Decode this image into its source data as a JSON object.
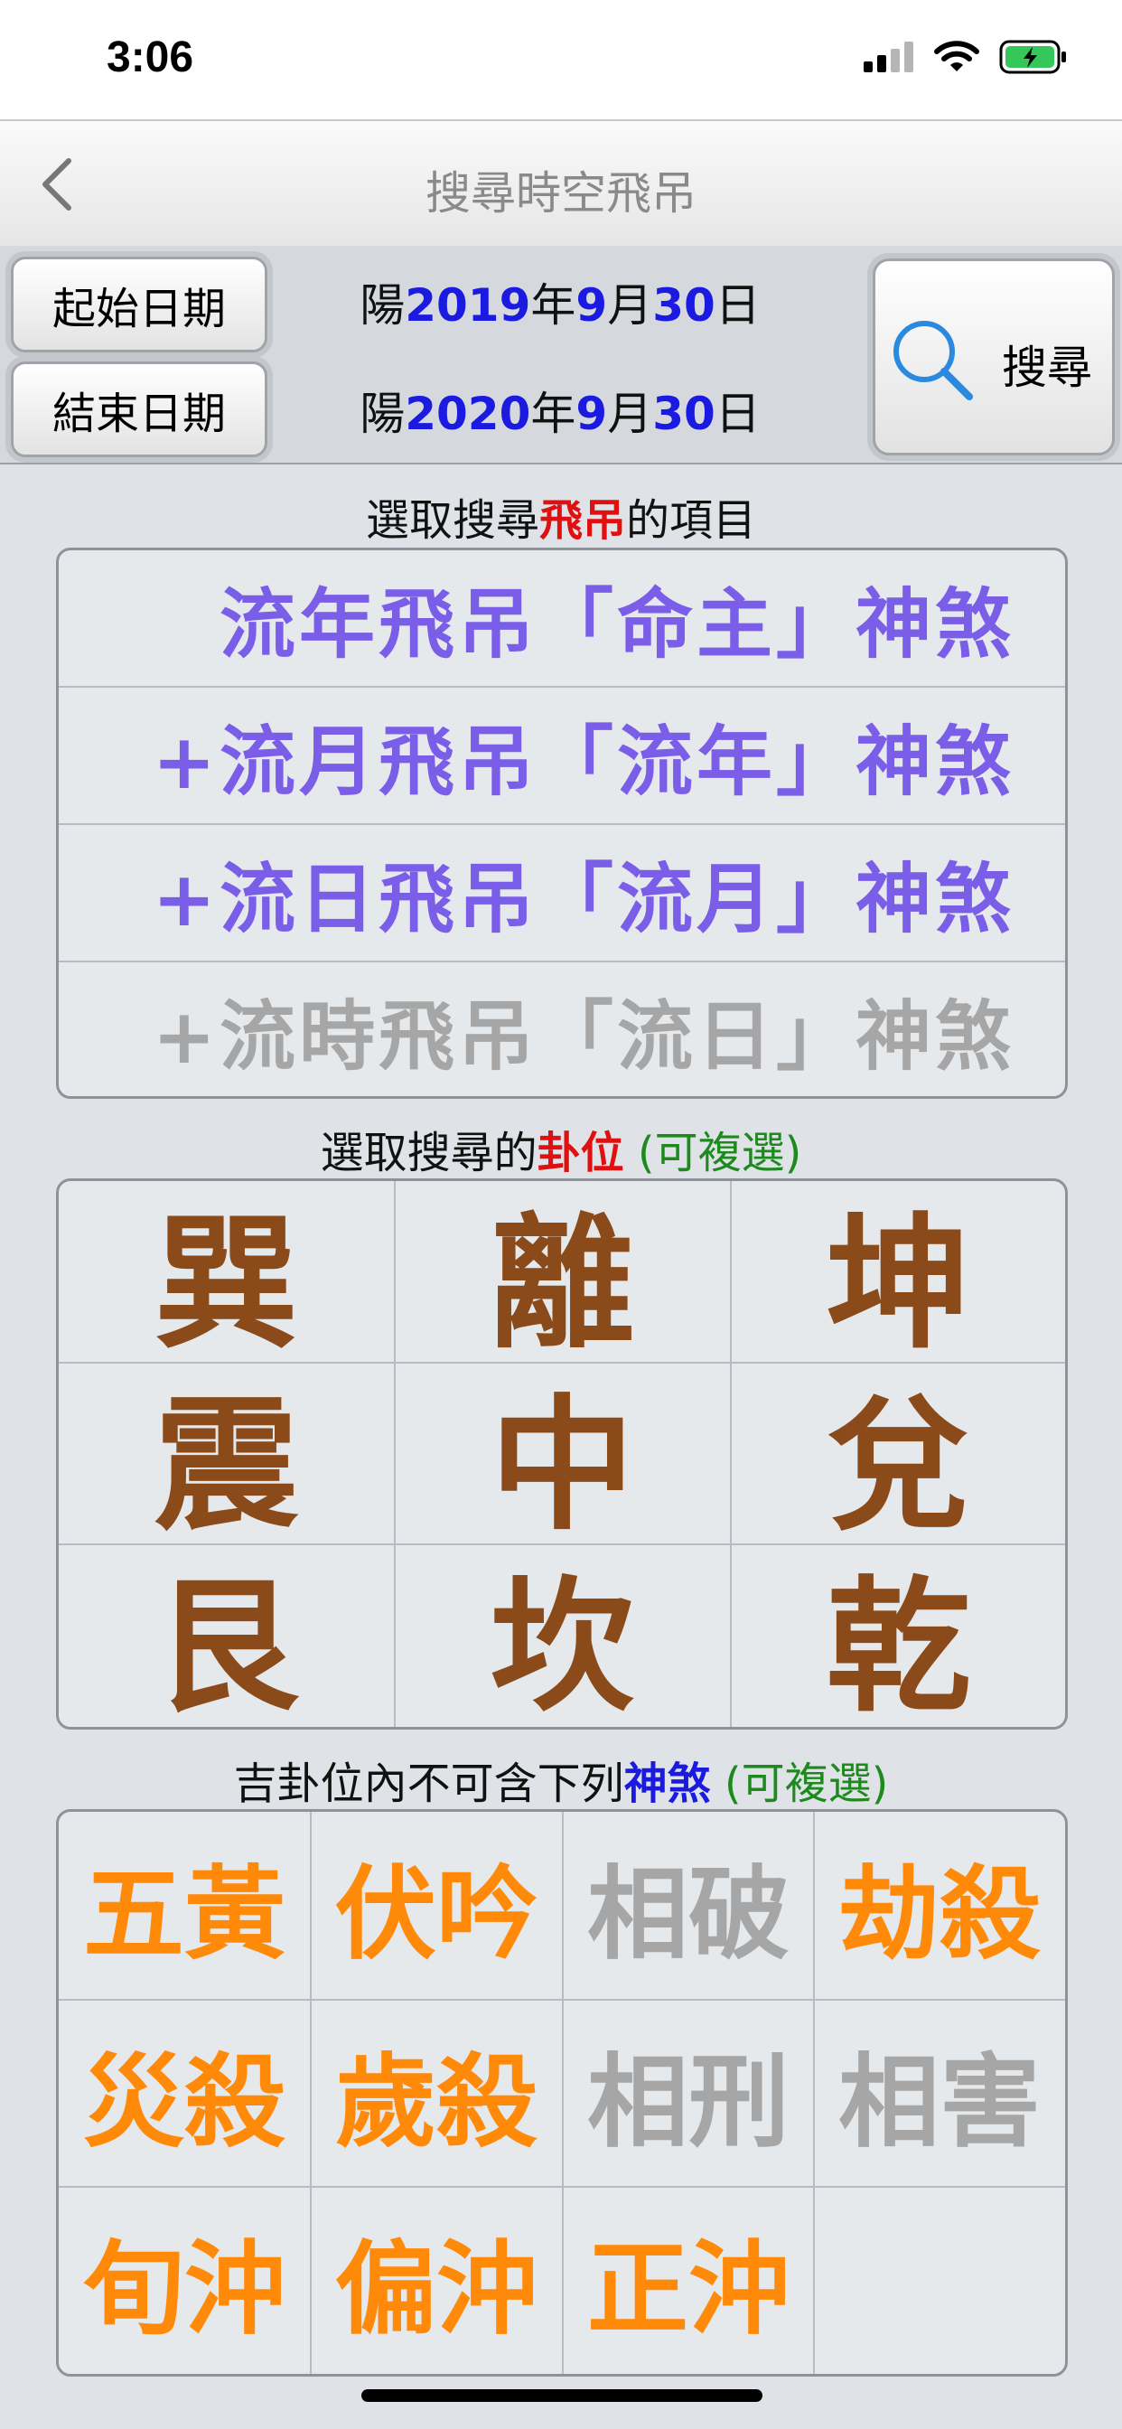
{
  "status_bar": {
    "time": "3:06"
  },
  "nav": {
    "title": "搜尋時空飛吊",
    "back_icon": "chevron-left-icon"
  },
  "dates": {
    "start_button": "起始日期",
    "end_button": "結束日期",
    "start": {
      "prefix": "陽",
      "year": "2019",
      "y": "年",
      "month": "9",
      "m": "月",
      "day": "30",
      "d": "日"
    },
    "end": {
      "prefix": "陽",
      "year": "2020",
      "y": "年",
      "month": "9",
      "m": "月",
      "day": "30",
      "d": "日"
    },
    "search_label": "搜尋"
  },
  "section1": {
    "pre": "選取搜尋",
    "highlight": "飛吊",
    "post": "的項目"
  },
  "fly_items": [
    {
      "label": "流年飛吊「命主」神煞",
      "active": true
    },
    {
      "label": "+流月飛吊「流年」神煞",
      "active": true
    },
    {
      "label": "+流日飛吊「流月」神煞",
      "active": true
    },
    {
      "label": "+流時飛吊「流日」神煞",
      "active": false
    }
  ],
  "section2": {
    "pre": "選取搜尋的",
    "highlight": "卦位",
    "note": " (可複選)"
  },
  "gua": [
    "巽",
    "離",
    "坤",
    "震",
    "中",
    "兌",
    "艮",
    "坎",
    "乾"
  ],
  "section3": {
    "pre": "吉卦位內不可含下列",
    "highlight": "神煞",
    "note": " (可複選)"
  },
  "shensha": [
    {
      "label": "五黃",
      "on": true
    },
    {
      "label": "伏吟",
      "on": true
    },
    {
      "label": "相破",
      "on": false
    },
    {
      "label": "劫殺",
      "on": true
    },
    {
      "label": "災殺",
      "on": true
    },
    {
      "label": "歲殺",
      "on": true
    },
    {
      "label": "相刑",
      "on": false
    },
    {
      "label": "相害",
      "on": false
    },
    {
      "label": "旬沖",
      "on": true
    },
    {
      "label": "偏沖",
      "on": true
    },
    {
      "label": "正沖",
      "on": true
    },
    {
      "label": "",
      "on": false
    }
  ],
  "colors": {
    "fly_active": "#7a5ee8",
    "fly_inactive": "#a6a6a6",
    "gua": "#8b4a1a",
    "shensha_on": "#ff8a0a",
    "shensha_off": "#a6a6a6",
    "date_number": "#1a1ae0",
    "highlight_red": "#e01010",
    "note_green": "#1e8a1e"
  }
}
